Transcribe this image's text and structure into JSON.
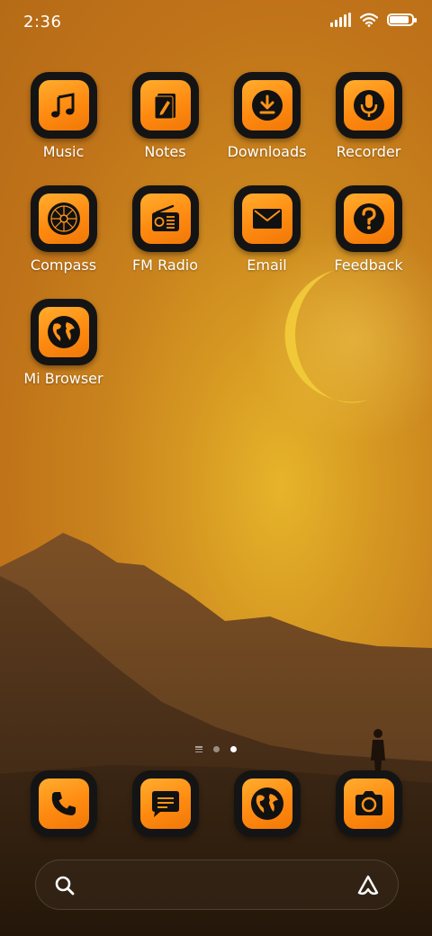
{
  "status_bar": {
    "time": "2:36",
    "battery_level": 0.95,
    "signal_bars": 4
  },
  "apps": [
    {
      "label": "Music",
      "icon": "music-note-icon"
    },
    {
      "label": "Notes",
      "icon": "notes-icon"
    },
    {
      "label": "Downloads",
      "icon": "download-icon"
    },
    {
      "label": "Recorder",
      "icon": "microphone-icon"
    },
    {
      "label": "Compass",
      "icon": "compass-icon"
    },
    {
      "label": "FM Radio",
      "icon": "radio-icon"
    },
    {
      "label": "Email",
      "icon": "envelope-icon"
    },
    {
      "label": "Feedback",
      "icon": "question-icon"
    },
    {
      "label": "Mi Browser",
      "icon": "globe-icon"
    }
  ],
  "page_indicator": {
    "pages": 2,
    "current": 2
  },
  "dock": [
    {
      "icon": "phone-icon"
    },
    {
      "icon": "messages-icon"
    },
    {
      "icon": "browser-globe-icon"
    },
    {
      "icon": "camera-icon"
    }
  ],
  "search_bar": {
    "search_icon": "search-icon",
    "assistant_icon": "assistant-icon"
  },
  "colors": {
    "icon_orange": "#ff9418",
    "icon_frame": "#141414",
    "sky": "#d79a22"
  }
}
